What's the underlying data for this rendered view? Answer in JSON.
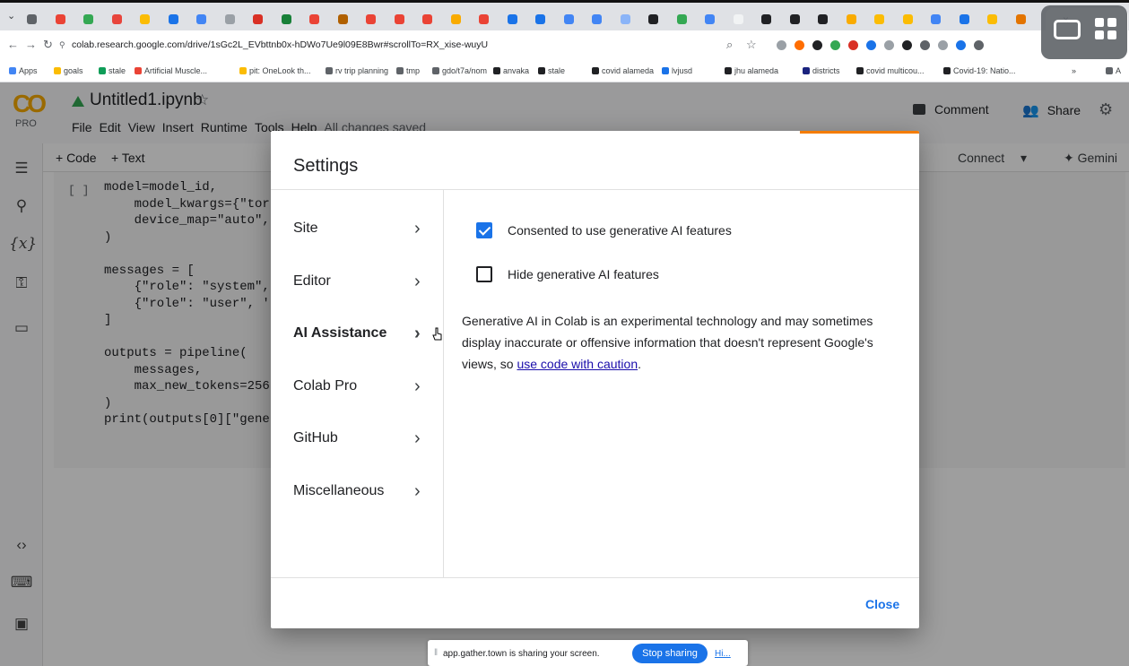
{
  "browser": {
    "url": "colab.research.google.com/drive/1sGc2L_EVbttnb0x-hDWo7Ue9l09E8Bwr#scrollTo=RX_xise-wuyU",
    "bookmarks": [
      {
        "label": "Apps",
        "color": "#4285f4"
      },
      {
        "label": "goals",
        "color": "#fbbc04"
      },
      {
        "label": "stale",
        "color": "#0f9d58"
      },
      {
        "label": "Artificial Muscle...",
        "color": "#ea4335"
      },
      {
        "label": "pit: OneLook th...",
        "color": "#fbbc04"
      },
      {
        "label": "rv trip planning",
        "color": "#5f6368"
      },
      {
        "label": "tmp",
        "color": "#5f6368"
      },
      {
        "label": "gdo/t7a/nom",
        "color": "#5f6368"
      },
      {
        "label": "anvaka",
        "color": "#202124"
      },
      {
        "label": "stale",
        "color": "#202124"
      },
      {
        "label": "covid alameda",
        "color": "#202124"
      },
      {
        "label": "lvjusd",
        "color": "#1a73e8"
      },
      {
        "label": "jhu alameda",
        "color": "#202124"
      },
      {
        "label": "districts",
        "color": "#1a237e"
      },
      {
        "label": "covid multicou...",
        "color": "#202124"
      },
      {
        "label": "Covid-19: Natio...",
        "color": "#202124"
      }
    ],
    "bookmarks_overflow": "»",
    "bookmarks_all": "A"
  },
  "colab": {
    "logo_text": "CO",
    "logo_badge": "PRO",
    "title": "Untitled1.ipynb",
    "menu": [
      "File",
      "Edit",
      "View",
      "Insert",
      "Runtime",
      "Tools",
      "Help"
    ],
    "save_status": "All changes saved",
    "comment_label": "Comment",
    "share_label": "Share",
    "add_code_label": "+ Code",
    "add_text_label": "+ Text",
    "connect_label": "Connect",
    "gemini_label": "Gemini",
    "run_bracket": "[ ]",
    "code": "model=model_id,\n    model_kwargs={\"tor\n    device_map=\"auto\",\n)\n\nmessages = [\n    {\"role\": \"system\",\n    {\"role\": \"user\", '\n]\n\noutputs = pipeline(\n    messages,\n    max_new_tokens=256\n)\nprint(outputs[0][\"gene"
  },
  "settings_dialog": {
    "title": "Settings",
    "nav": [
      {
        "label": "Site",
        "active": false
      },
      {
        "label": "Editor",
        "active": false
      },
      {
        "label": "AI Assistance",
        "active": true
      },
      {
        "label": "Colab Pro",
        "active": false
      },
      {
        "label": "GitHub",
        "active": false
      },
      {
        "label": "Miscellaneous",
        "active": false
      }
    ],
    "consent_label": "Consented to use generative AI features",
    "consent_checked": true,
    "hide_label": "Hide generative AI features",
    "hide_checked": false,
    "description": "Generative AI in Colab is an experimental technology and may sometimes display inaccurate or offensive information that doesn't represent Google's views, so ",
    "description_link": "use code with caution",
    "description_end": ".",
    "close_label": "Close"
  },
  "share_banner": {
    "text": "app.gather.town is sharing your screen.",
    "stop_label": "Stop sharing",
    "hide_label": "Hi..."
  },
  "colors": {
    "accent_blue": "#1a73e8",
    "colab_orange": "#f9ab00",
    "dialog_accent": "#f57c00"
  }
}
